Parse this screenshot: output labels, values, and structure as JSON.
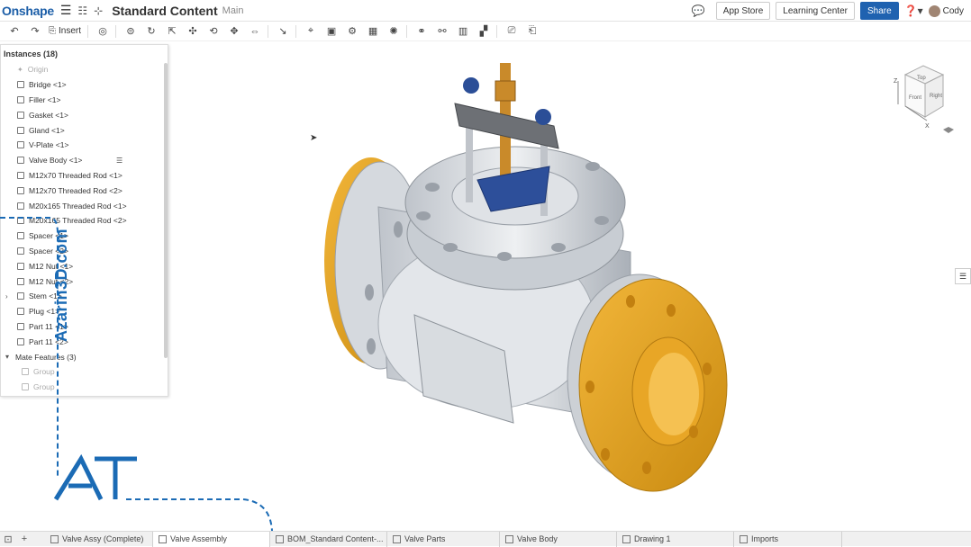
{
  "header": {
    "logo": "Onshape",
    "doc_title": "Standard Content",
    "branch": "Main",
    "app_store": "App Store",
    "learning_center": "Learning Center",
    "share": "Share",
    "help": "?",
    "user": "Cody"
  },
  "toolbar": {
    "insert_label": "Insert"
  },
  "instances": {
    "title": "Instances (18)",
    "items": [
      {
        "label": "Origin",
        "kind": "origin"
      },
      {
        "label": "Bridge <1>",
        "kind": "part"
      },
      {
        "label": "Filler <1>",
        "kind": "part"
      },
      {
        "label": "Gasket <1>",
        "kind": "part"
      },
      {
        "label": "Gland <1>",
        "kind": "part"
      },
      {
        "label": "V-Plate <1>",
        "kind": "part"
      },
      {
        "label": "Valve Body <1>",
        "kind": "part"
      },
      {
        "label": "M12x70 Threaded Rod <1>",
        "kind": "part"
      },
      {
        "label": "M12x70 Threaded Rod <2>",
        "kind": "part"
      },
      {
        "label": "M20x165 Threaded Rod <1>",
        "kind": "part"
      },
      {
        "label": "M20x165 Threaded Rod <2>",
        "kind": "part"
      },
      {
        "label": "Spacer <1>",
        "kind": "part"
      },
      {
        "label": "Spacer <2>",
        "kind": "part"
      },
      {
        "label": "M12 Nut <1>",
        "kind": "part"
      },
      {
        "label": "M12 Nut <2>",
        "kind": "part"
      },
      {
        "label": "Stem <1>",
        "kind": "sub"
      },
      {
        "label": "Plug <1>",
        "kind": "part"
      },
      {
        "label": "Part 11 <1>",
        "kind": "part"
      },
      {
        "label": "Part 11 <2>",
        "kind": "part"
      },
      {
        "label": "Mate Features (3)",
        "kind": "section"
      },
      {
        "label": "Group",
        "kind": "group"
      },
      {
        "label": "Group",
        "kind": "group"
      }
    ]
  },
  "view_cube": {
    "top": "Top",
    "front": "Front",
    "right": "Right",
    "axis_x": "X",
    "axis_z": "Z"
  },
  "watermark": "Azarin3D.com",
  "tabs": [
    {
      "label": "Valve Assy (Complete)",
      "active": false
    },
    {
      "label": "Valve Assembly",
      "active": true
    },
    {
      "label": "BOM_Standard Content-...",
      "active": false
    },
    {
      "label": "Valve Parts",
      "active": false
    },
    {
      "label": "Valve Body",
      "active": false
    },
    {
      "label": "Drawing 1",
      "active": false
    },
    {
      "label": "Imports",
      "active": false
    }
  ]
}
